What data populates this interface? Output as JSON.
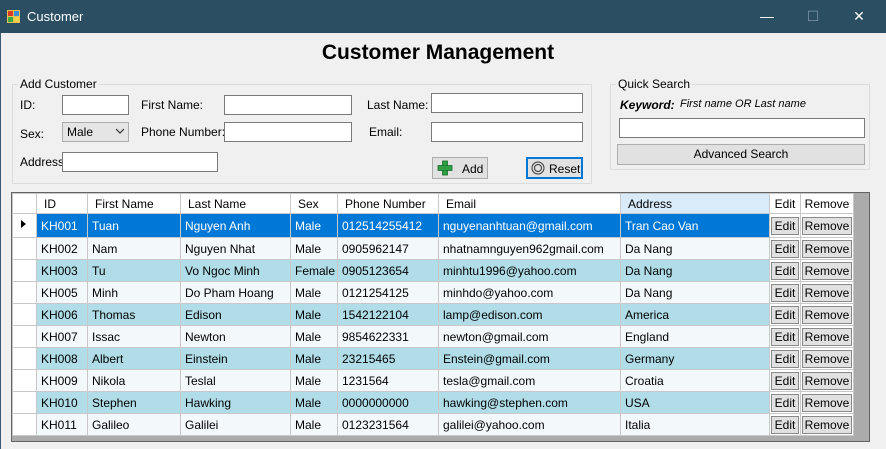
{
  "window": {
    "title": "Customer",
    "minimize": "—",
    "maximize": "☐",
    "close": "✕"
  },
  "heading": "Customer Management",
  "add_customer": {
    "legend": "Add Customer",
    "id_label": "ID:",
    "first_name_label": "First Name:",
    "last_name_label": "Last Name:",
    "sex_label": "Sex:",
    "sex_value": "Male",
    "phone_label": "Phone Number:",
    "email_label": "Email:",
    "address_label": "Address:",
    "add_button": "Add",
    "reset_button": "Reset"
  },
  "quick_search": {
    "legend": "Quick Search",
    "keyword_label": "Keyword:",
    "hint": "First name OR Last name",
    "advanced_button": "Advanced Search"
  },
  "grid": {
    "columns": [
      "ID",
      "First Name",
      "Last Name",
      "Sex",
      "Phone Number",
      "Email",
      "Address",
      "Edit",
      "Remove"
    ],
    "edit_label": "Edit",
    "remove_label": "Remove",
    "rows": [
      [
        "KH001",
        "Tuan",
        "Nguyen Anh",
        "Male",
        "012514255412",
        "nguyenanhtuan@gmail.com",
        "Tran Cao Van"
      ],
      [
        "KH002",
        "Nam",
        "Nguyen Nhat",
        "Male",
        "0905962147",
        "nhatnamnguyen962gmail.com",
        "Da Nang"
      ],
      [
        "KH003",
        "Tu",
        "Vo Ngoc Minh",
        "Female",
        "0905123654",
        "minhtu1996@yahoo.com",
        "Da Nang"
      ],
      [
        "KH005",
        "Minh",
        "Do Pham Hoang",
        "Male",
        "0121254125",
        "minhdo@yahoo.com",
        "Da Nang"
      ],
      [
        "KH006",
        "Thomas",
        "Edison",
        "Male",
        "1542122104",
        "lamp@edison.com",
        "America"
      ],
      [
        "KH007",
        "Issac",
        "Newton",
        "Male",
        "9854622331",
        "newton@gmail.com",
        "England"
      ],
      [
        "KH008",
        "Albert",
        "Einstein",
        "Male",
        "23215465",
        "Enstein@gmail.com",
        "Germany"
      ],
      [
        "KH009",
        "Nikola",
        "Teslal",
        "Male",
        "1231564",
        "tesla@gmail.com",
        "Croatia"
      ],
      [
        "KH010",
        "Stephen",
        "Hawking",
        "Male",
        "0000000000",
        "hawking@stephen.com",
        "USA"
      ],
      [
        "KH011",
        "Galileo",
        "Galilei",
        "Male",
        "0123231564",
        "galilei@yahoo.com",
        "Italia"
      ]
    ]
  },
  "colors": {
    "titlebar": "#2b4e63",
    "selected_row": "#0078d7",
    "alt_row": "#b0dde8",
    "row": "#f3f8fb"
  },
  "icons": {
    "app": "app-icon",
    "add": "plus-icon",
    "reset": "reset-icon",
    "current_row": "row-pointer-icon"
  }
}
